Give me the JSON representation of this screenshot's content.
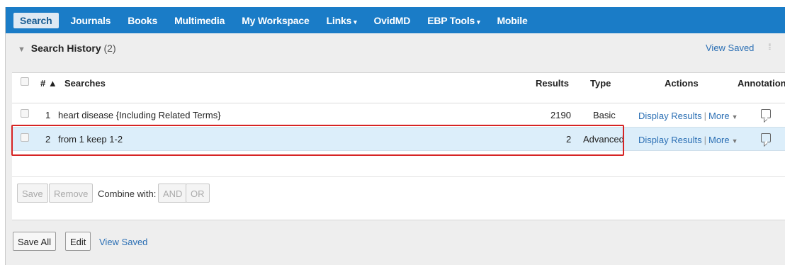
{
  "nav": {
    "items": [
      {
        "label": "Search",
        "active": true
      },
      {
        "label": "Journals"
      },
      {
        "label": "Books"
      },
      {
        "label": "Multimedia"
      },
      {
        "label": "My Workspace"
      },
      {
        "label": "Links",
        "caret": "▾"
      },
      {
        "label": "OvidMD"
      },
      {
        "label": "EBP Tools",
        "caret": "▾"
      },
      {
        "label": "Mobile"
      }
    ]
  },
  "history": {
    "title": "Search History",
    "count": "(2)",
    "view_saved": "View Saved"
  },
  "table": {
    "headers": {
      "num": "# ▲",
      "searches": "Searches",
      "results": "Results",
      "type": "Type",
      "actions": "Actions",
      "annotations": "Annotations"
    },
    "rows": [
      {
        "num": "1",
        "search": "heart disease {Including Related Terms}",
        "results": "2190",
        "type": "Basic",
        "display": "Display Results",
        "more": "More"
      },
      {
        "num": "2",
        "search": "from 1 keep 1-2",
        "results": "2",
        "type": "Advanced",
        "display": "Display Results",
        "more": "More",
        "highlighted": true
      }
    ]
  },
  "toolbar": {
    "save": "Save",
    "remove": "Remove",
    "combine_label": "Combine with:",
    "and": "AND",
    "or": "OR"
  },
  "footer": {
    "save_all": "Save All",
    "edit": "Edit",
    "view_saved": "View Saved"
  },
  "colors": {
    "nav_bg": "#1a7cc7",
    "highlight_border": "#d62424",
    "selected_row": "#dceefa",
    "link": "#2b6fb4"
  }
}
